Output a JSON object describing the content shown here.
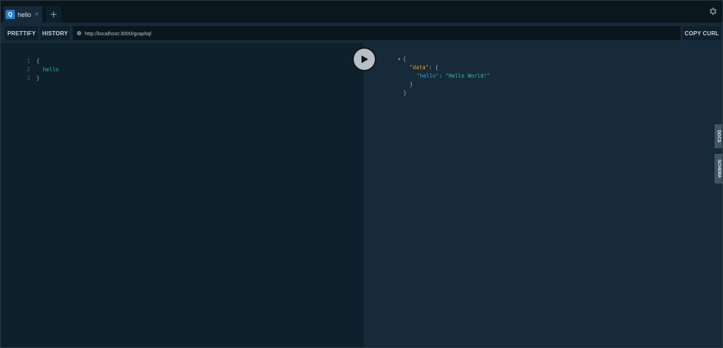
{
  "tabs": [
    {
      "badge": "Q",
      "label": "hello",
      "close": "×"
    }
  ],
  "new_tab": "+",
  "toolbar": {
    "prettify_label": "PRETTIFY",
    "history_label": "HISTORY",
    "endpoint_url": "http://localhost:3000/graphql",
    "copy_curl_label": "COPY CURL"
  },
  "editor": {
    "lines": [
      {
        "num": "1",
        "text": "{"
      },
      {
        "num": "2",
        "text": "hello"
      },
      {
        "num": "3",
        "text": "}"
      }
    ]
  },
  "result": {
    "fold_marker": "▾",
    "lines": [
      "{",
      "\"data\"",
      ": {",
      "\"hello\"",
      ": ",
      "\"Hello World!\"",
      "}",
      "}"
    ]
  },
  "sidebar": {
    "docs_label": "DOCS",
    "schema_label": "SCHEMA"
  },
  "colors": {
    "key_data": "#e3a130",
    "key_hello": "#38a2d8",
    "string": "#2fc49a",
    "field": "#33b37f",
    "punct": "#9fb0bb",
    "accent": "#2a7ed2"
  },
  "icons": {
    "settings": "gear-icon",
    "run": "play-icon"
  }
}
